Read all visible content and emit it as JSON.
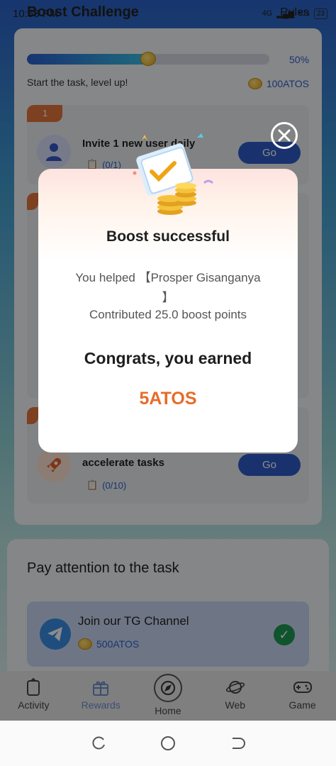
{
  "status_bar": {
    "time": "10:53 PM",
    "network": "4G",
    "data_speed": "K/s",
    "battery": "23"
  },
  "header": {
    "title": "Boost Challenge",
    "rules_label": "Rules"
  },
  "progress": {
    "fraction": 0.5,
    "percent_label": "50%",
    "caption": "Start the task, level up!",
    "reward_total": "100ATOS"
  },
  "tasks": [
    {
      "badge": "1",
      "title": "Invite 1 new user daily",
      "progress": "(0/1)",
      "go_label": "Go"
    },
    {
      "badge": "",
      "title": "accelerate tasks",
      "progress": "(0/10)",
      "go_label": "Go"
    }
  ],
  "attention": {
    "title": "Pay attention to the task",
    "tg_title": "Join our TG Channel",
    "tg_reward": "500ATOS"
  },
  "modal": {
    "title": "Boost successful",
    "helped_text": "You helped 【Prosper Gisanganya 】",
    "contributed_text": "Contributed 25.0 boost points",
    "congrats_text": "Congrats, you earned",
    "earned_amount": "5ATOS"
  },
  "nav": {
    "items": [
      {
        "label": "Activity",
        "icon": "activity-icon"
      },
      {
        "label": "Rewards",
        "icon": "gift-icon"
      },
      {
        "label": "Home",
        "icon": "home-compass-icon"
      },
      {
        "label": "Web",
        "icon": "planet-icon"
      },
      {
        "label": "Game",
        "icon": "gamepad-icon"
      }
    ]
  },
  "colors": {
    "accent_blue": "#2f5cc8",
    "earn_orange": "#e76c2a",
    "badge_orange": "#e4753b"
  }
}
